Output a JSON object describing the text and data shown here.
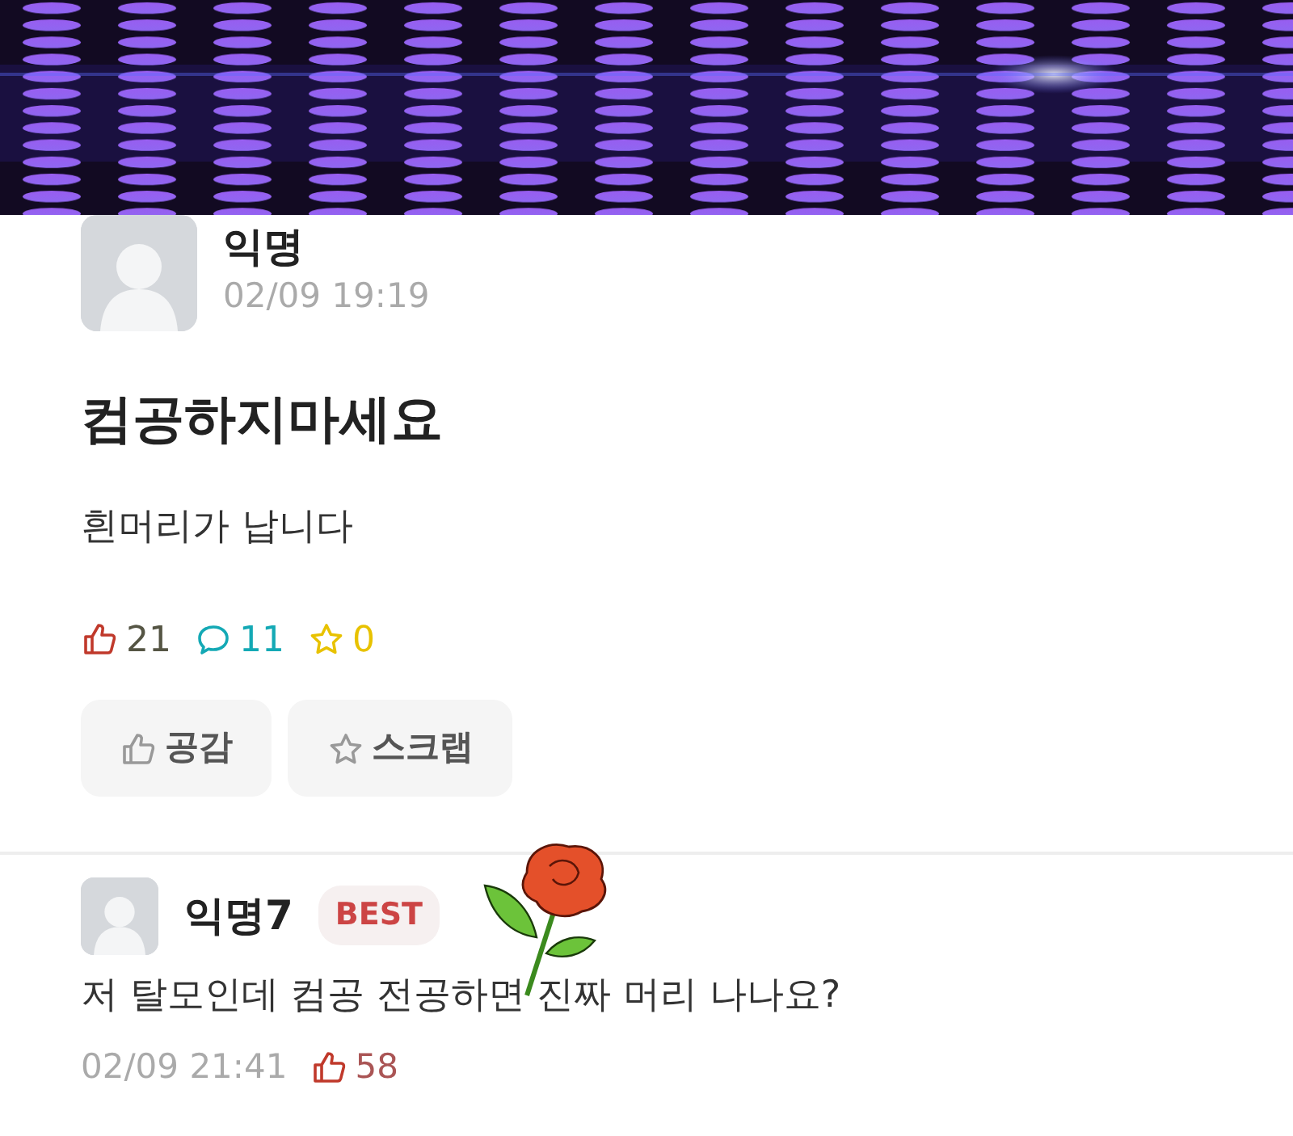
{
  "post": {
    "author": "익명",
    "time": "02/09 19:19",
    "title": "컴공하지마세요",
    "body": "흰머리가 납니다",
    "stats": [
      {
        "kind": "like",
        "count": "21",
        "color": "#c0392b"
      },
      {
        "kind": "comment",
        "count": "11",
        "color": "#14a9b5"
      },
      {
        "kind": "scrap",
        "count": "0",
        "color": "#e8c200"
      }
    ],
    "actions": [
      {
        "kind": "like",
        "label": "공감"
      },
      {
        "kind": "scrap",
        "label": "스크랩"
      }
    ]
  },
  "comments": [
    {
      "author": "익명7",
      "badge": "BEST",
      "text": "저 탈모인데 컴공 전공하면 진짜 머리 나나요?",
      "time": "02/09 21:41",
      "likes": "58"
    }
  ],
  "sticker": {
    "kind": "rose"
  }
}
